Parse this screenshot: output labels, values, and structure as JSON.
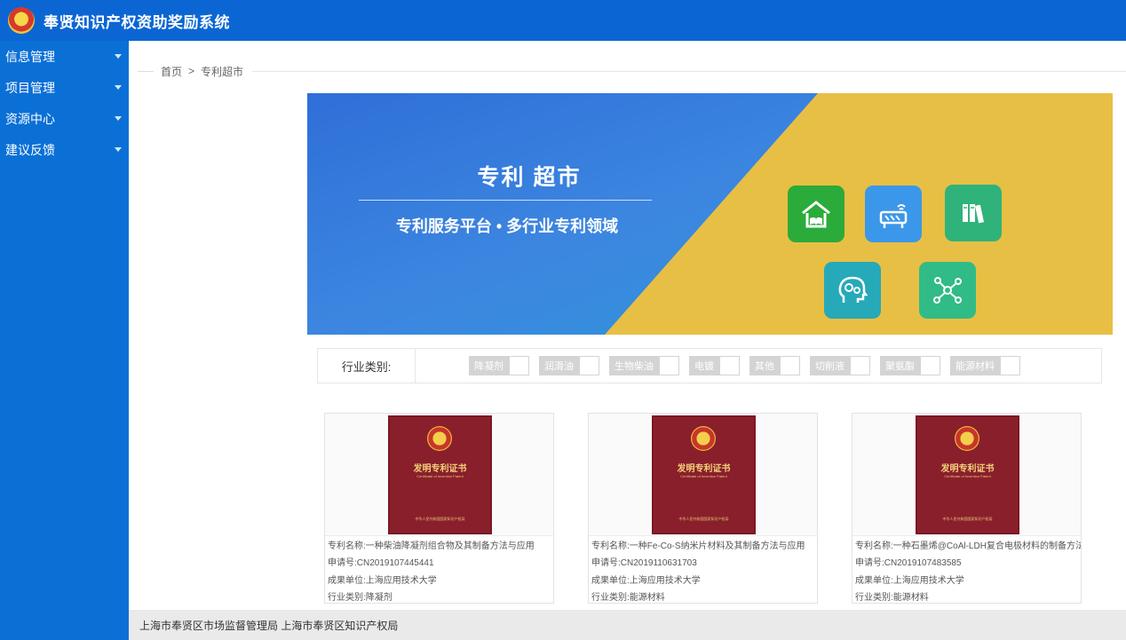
{
  "header": {
    "title": "奉贤知识产权资助奖励系统"
  },
  "sidebar": {
    "items": [
      {
        "label": "信息管理"
      },
      {
        "label": "项目管理"
      },
      {
        "label": "资源中心"
      },
      {
        "label": "建议反馈"
      }
    ]
  },
  "breadcrumb": {
    "home": "首页",
    "separator": ">",
    "current": "专利超市"
  },
  "banner": {
    "title": "专利 超市",
    "subtitle": "专利服务平台 • 多行业专利领域",
    "colors": {
      "blue": "#2f6fd8",
      "yellow": "#e8bf45"
    },
    "tiles": [
      {
        "icon": "home-book-icon",
        "color": "#2bab3a"
      },
      {
        "icon": "wifi-device-icon",
        "color": "#3b97e9"
      },
      {
        "icon": "books-icon",
        "color": "#2fb37a"
      },
      {
        "icon": "brain-gears-icon",
        "color": "#26a9b8"
      },
      {
        "icon": "network-nodes-icon",
        "color": "#31bb86"
      }
    ]
  },
  "filter": {
    "label": "行业类别:",
    "categories": [
      "降凝剂",
      "润滑油",
      "生物柴油",
      "电镀",
      "其他",
      "切削液",
      "聚氨酯",
      "能源材料"
    ]
  },
  "cards": [
    {
      "cert_title": "发明专利证书",
      "cert_subtitle": "Certificate of Invention Patent",
      "cert_issuer": "中华人民共和国国家知识产权局",
      "name": "专利名称:一种柴油降凝剂组合物及其制备方法与应用",
      "app_no": "申请号:CN2019107445441",
      "unit": "成果单位:上海应用技术大学",
      "category": "行业类别:降凝剂"
    },
    {
      "cert_title": "发明专利证书",
      "cert_subtitle": "Certificate of Invention Patent",
      "cert_issuer": "中华人民共和国国家知识产权局",
      "name": "专利名称:一种Fe-Co-S纳米片材料及其制备方法与应用",
      "app_no": "申请号:CN2019110631703",
      "unit": "成果单位:上海应用技术大学",
      "category": "行业类别:能源材料"
    },
    {
      "cert_title": "发明专利证书",
      "cert_subtitle": "Certificate of Invention Patent",
      "cert_issuer": "中华人民共和国国家知识产权局",
      "name": "专利名称:一种石墨烯@CoAl-LDH复合电极材料的制备方法",
      "app_no": "申请号:CN2019107483585",
      "unit": "成果单位:上海应用技术大学",
      "category": "行业类别:能源材料"
    }
  ],
  "footer": {
    "text": "上海市奉贤区市场监督管理局 上海市奉贤区知识产权局"
  }
}
